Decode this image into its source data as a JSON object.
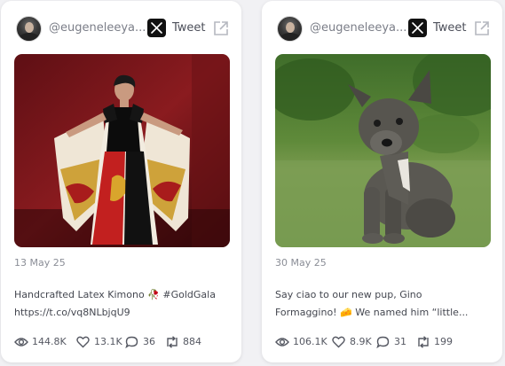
{
  "cards": [
    {
      "handle": "@eugeneleeya...",
      "platform": "Tweet",
      "date": "13 May 25",
      "text_line1": "Handcrafted Latex Kimono 🥀 #GoldGala",
      "text_line2": "https://t.co/vq8NLbjqU9",
      "image": "photo of a person in a black latex and white kimono with red and gold dragon pattern",
      "stats": {
        "views": "144.8K",
        "likes": "13.1K",
        "replies": "36",
        "reposts": "884"
      }
    },
    {
      "handle": "@eugeneleeya...",
      "platform": "Tweet",
      "date": "30 May 25",
      "text_line1": "Say ciao to our new pup, Gino",
      "text_line2": "Formaggino! 🧀 We named him “little...",
      "image": "photo of a small grey brindle puppy sitting on grass",
      "stats": {
        "views": "106.1K",
        "likes": "8.9K",
        "replies": "31",
        "reposts": "199"
      }
    }
  ],
  "icons": {
    "platform": "x-logo-icon",
    "open": "external-link-icon",
    "views": "eye-icon",
    "likes": "heart-icon",
    "replies": "comment-icon",
    "reposts": "repost-icon"
  },
  "colors": {
    "card_bg": "#ffffff",
    "page_bg": "#f1f1f4",
    "text_muted": "#7b7e88"
  }
}
